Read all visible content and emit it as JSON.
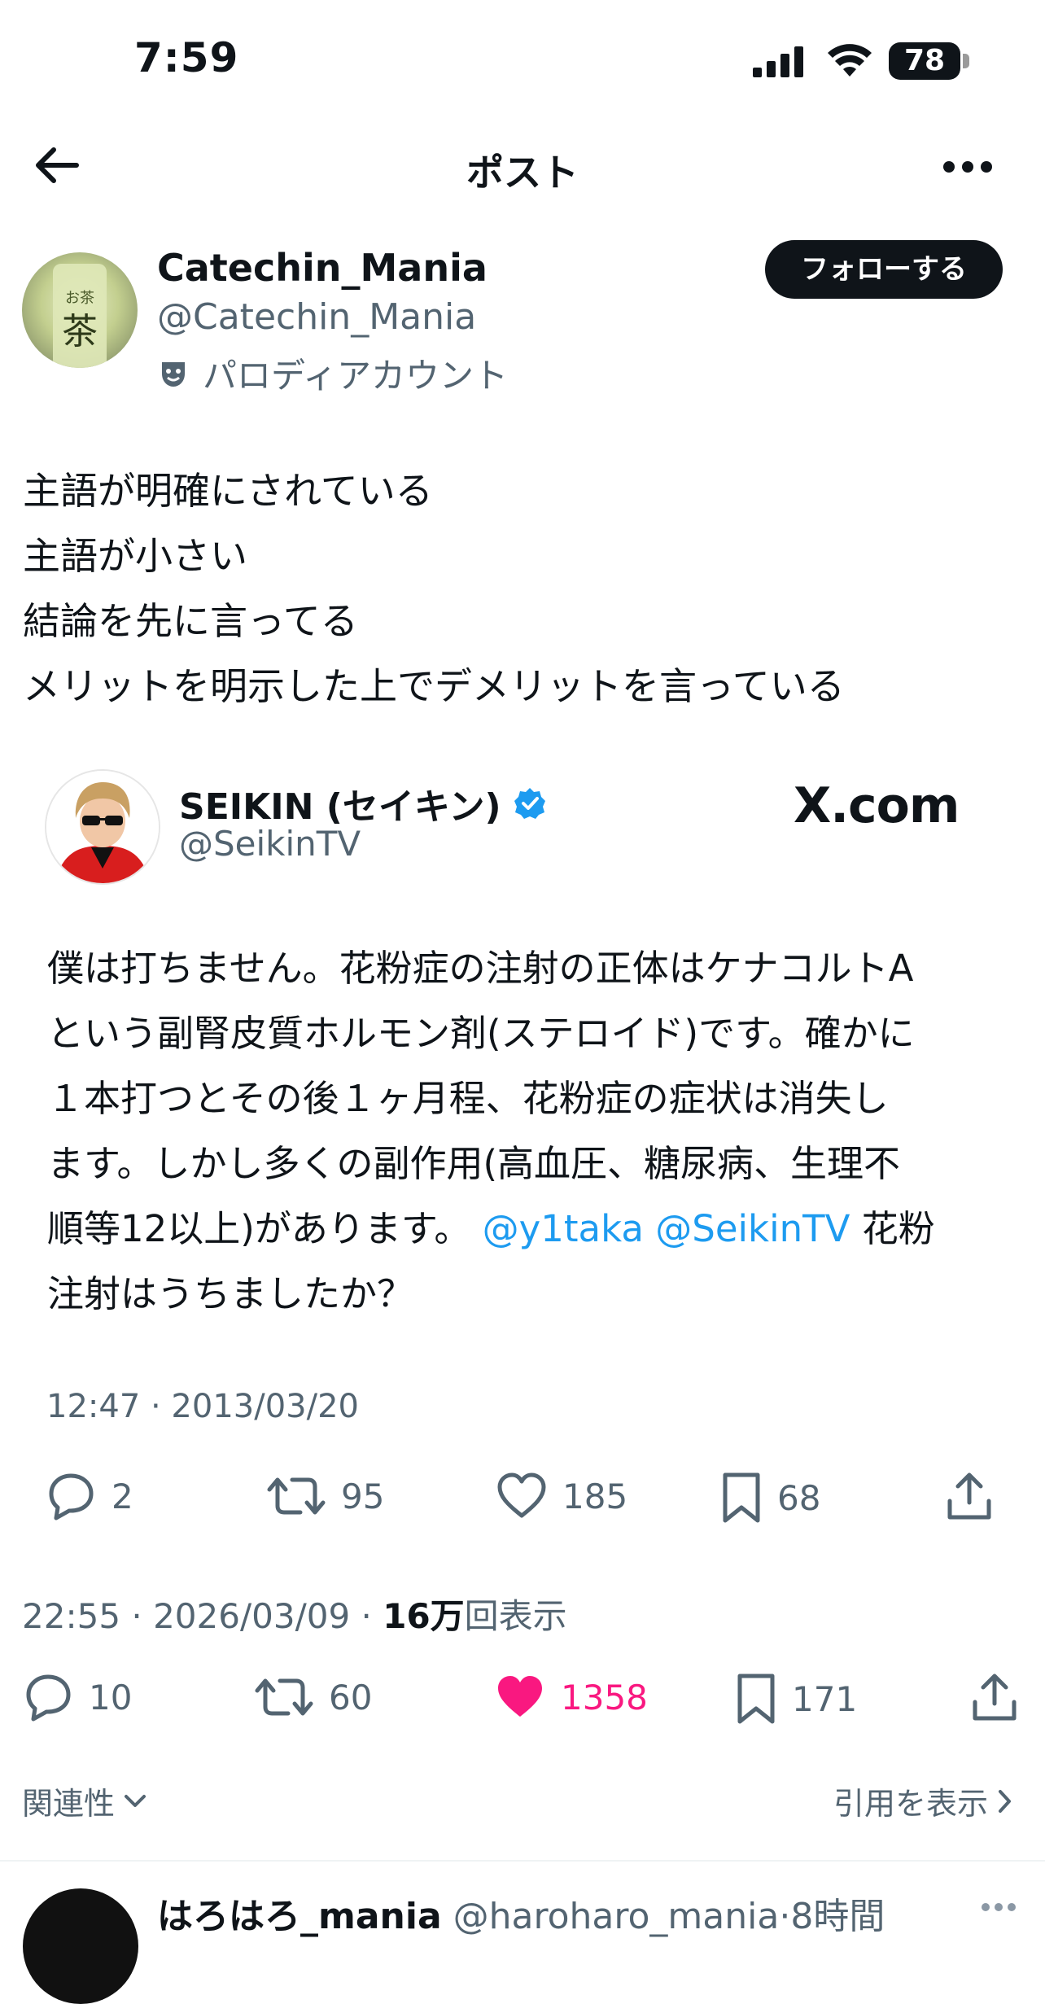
{
  "status_bar": {
    "time": "7:59",
    "battery": "78"
  },
  "nav": {
    "title": "ポスト"
  },
  "author": {
    "display_name": "Catechin_Mania",
    "handle": "@Catechin_Mania",
    "label": "パロディアカウント",
    "follow_label": "フォローする"
  },
  "post": {
    "lines": [
      "主語が明確にされている",
      "主語が小さい",
      "結論を先に言ってる",
      "メリットを明示した上でデメリットを言っている"
    ],
    "timestamp": "22:55 · 2026/03/09 · ",
    "views_count": "16万",
    "views_suffix": "回表示",
    "replies": "10",
    "reposts": "60",
    "likes": "1358",
    "bookmarks": "171"
  },
  "quoted": {
    "display_name": "SEIKIN (セイキン)",
    "handle": "@SeikinTV",
    "source": "X.com",
    "text_lines": [
      "僕は打ちません。花粉症の注射の正体はケナコルトA",
      "という副腎皮質ホルモン剤(ステロイド)です。確かに",
      "１本打つとその後１ヶ月程、花粉症の症状は消失し",
      "ます。しかし多くの副作用(高血圧、糖尿病、生理不"
    ],
    "line5_prefix": "順等12以上)があります。",
    "mention1": "@y1taka",
    "mention2": "@SeikinTV",
    "line5_suffix": "花粉",
    "line6": "注射はうちましたか？",
    "date": "12:47 · 2013/03/20",
    "replies": "2",
    "reposts": "95",
    "likes": "185",
    "bookmarks": "68"
  },
  "sort": {
    "relevance": "関連性",
    "show_quotes": "引用を表示"
  },
  "reply": {
    "display_name": "はろはろ_mania",
    "handle": "@haroharo_mania",
    "time": "8時間"
  },
  "colors": {
    "like_active": "#f91880",
    "mention": "#1d9bf0",
    "verified": "#1d9bf0"
  }
}
